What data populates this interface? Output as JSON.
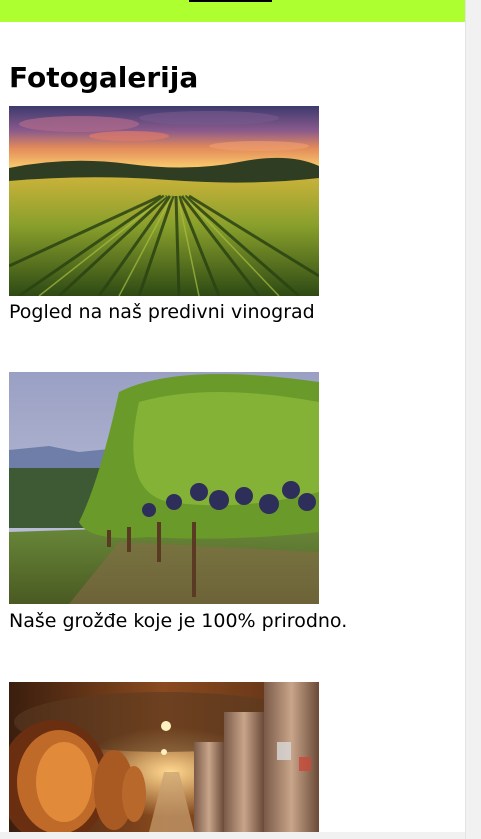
{
  "header": {
    "bar_color": "#adff2f"
  },
  "gallery": {
    "title": "Fotogalerija",
    "items": [
      {
        "image": "vineyard-sunset-photo",
        "caption": "Pogled na naš predivni vinograd"
      },
      {
        "image": "grape-vines-photo",
        "caption": "Naše grožđe koje je 100% prirodno."
      },
      {
        "image": "wine-cellar-photo",
        "caption": ""
      }
    ]
  }
}
